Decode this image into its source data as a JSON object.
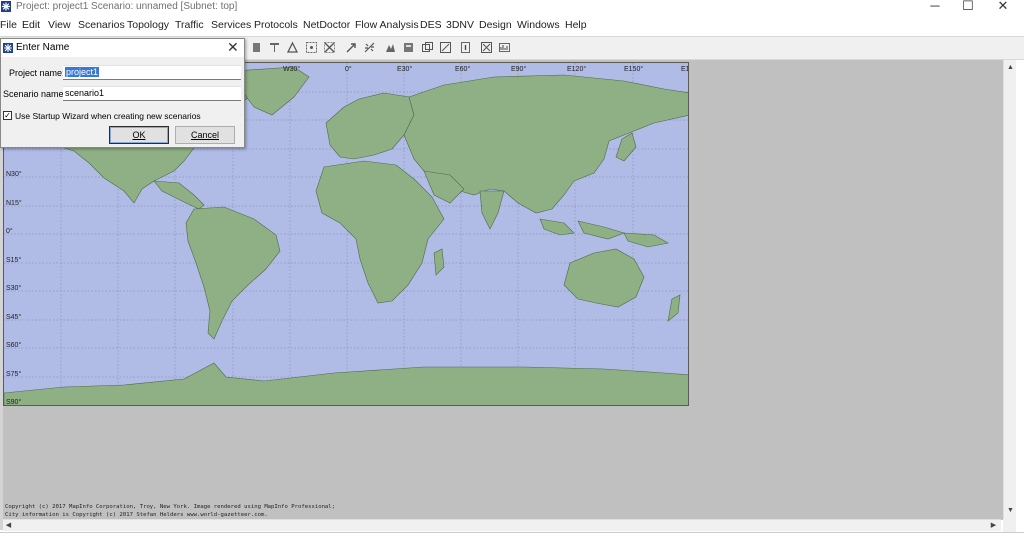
{
  "window": {
    "title": "Project: project1 Scenario: unnamed  [Subnet: top]",
    "minimize_glyph": "─",
    "maximize_glyph": "☐",
    "close_glyph": "✕"
  },
  "menu": [
    {
      "label": "File"
    },
    {
      "label": "Edit"
    },
    {
      "label": "View"
    },
    {
      "label": "Scenarios"
    },
    {
      "label": "Topology"
    },
    {
      "label": "Traffic"
    },
    {
      "label": "Services"
    },
    {
      "label": "Protocols"
    },
    {
      "label": "NetDoctor"
    },
    {
      "label": "Flow Analysis"
    },
    {
      "label": "DES"
    },
    {
      "label": "3DNV"
    },
    {
      "label": "Design"
    },
    {
      "label": "Windows"
    },
    {
      "label": "Help"
    }
  ],
  "map": {
    "longitude_labels": [
      "W30°",
      "0°",
      "E30°",
      "E60°",
      "E90°",
      "E120°",
      "E150°",
      "E1"
    ],
    "latitude_labels": [
      "N30°",
      "N15°",
      "0°",
      "S15°",
      "S30°",
      "S45°",
      "S60°",
      "S75°",
      "S90°"
    ],
    "ocean_color": "#b0bbe6",
    "land_color": "#8fb084",
    "copyright": [
      "Copyright (c) 2017 MapInfo Corporation, Troy, New York. Image rendered using MapInfo Professional;",
      "City information is Copyright (c) 2017 Stefan Helders www.world-gazetteer.com."
    ]
  },
  "dialog": {
    "title": "Enter Name",
    "close_glyph": "✕",
    "project_label": "Project name:",
    "project_value": "project1",
    "scenario_label": "Scenario name:",
    "scenario_value": "scenario1",
    "checkbox_checked": true,
    "checkbox_label": "Use Startup Wizard when creating new scenarios",
    "ok_label": "OK",
    "cancel_label": "Cancel"
  },
  "toolbar_icons": [
    "node-icon",
    "link-icon",
    "subnet-icon",
    "triangle-icon",
    "select-icon",
    "grid-icon",
    "arrow-icon",
    "wand-icon",
    "gear-icon",
    "tower-icon",
    "window-icon",
    "tile-icon",
    "zoom-icon",
    "info-icon",
    "layout-icon",
    "chart-icon"
  ]
}
